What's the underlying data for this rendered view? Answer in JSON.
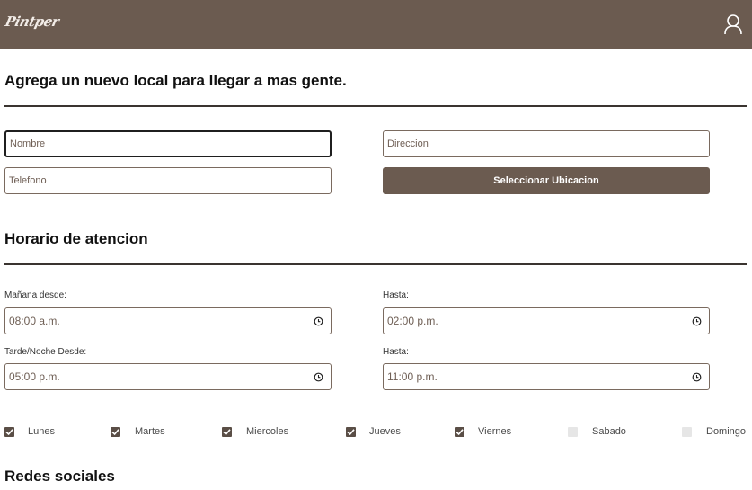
{
  "header": {
    "logo": "Pintper",
    "user_icon": "user-icon"
  },
  "page": {
    "title": "Agrega un nuevo local para llegar a mas gente."
  },
  "form": {
    "nombre_placeholder": "Nombre",
    "direccion_placeholder": "Direccion",
    "telefono_placeholder": "Telefono",
    "select_location_label": "Seleccionar Ubicacion"
  },
  "schedule": {
    "title": "Horario de atencion",
    "morning_from_label": "Mañana desde:",
    "morning_from_value": "08:00 a.m.",
    "morning_to_label": "Hasta:",
    "morning_to_value": "02:00 p.m.",
    "evening_from_label": "Tarde/Noche Desde:",
    "evening_from_value": "05:00 p.m.",
    "evening_to_label": "Hasta:",
    "evening_to_value": "11:00 p.m."
  },
  "days": [
    {
      "label": "Lunes",
      "checked": true
    },
    {
      "label": "Martes",
      "checked": true
    },
    {
      "label": "Miercoles",
      "checked": true
    },
    {
      "label": "Jueves",
      "checked": true
    },
    {
      "label": "Viernes",
      "checked": true
    },
    {
      "label": "Sabado",
      "checked": false
    },
    {
      "label": "Domingo",
      "checked": false
    }
  ],
  "social": {
    "title": "Redes sociales"
  },
  "colors": {
    "brand": "#6b5b50",
    "checkbox_on": "#5a4e46",
    "checkbox_off": "#e6e6e6"
  }
}
